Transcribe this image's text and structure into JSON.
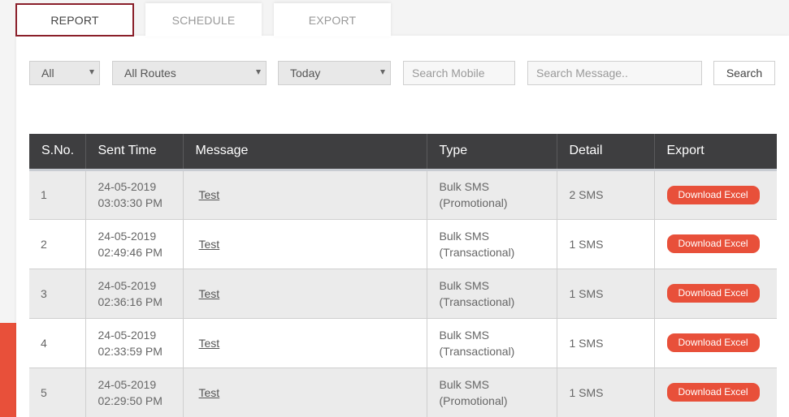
{
  "tabs": [
    {
      "label": "REPORT",
      "active": true
    },
    {
      "label": "SCHEDULE",
      "active": false
    },
    {
      "label": "EXPORT",
      "active": false
    }
  ],
  "filters": {
    "status": {
      "value": "All"
    },
    "routes": {
      "value": "All Routes"
    },
    "date": {
      "value": "Today"
    },
    "mobile": {
      "placeholder": "Search Mobile"
    },
    "message": {
      "placeholder": "Search Message.."
    },
    "search_label": "Search"
  },
  "table": {
    "headers": [
      "S.No.",
      "Sent Time",
      "Message",
      "Type",
      "Detail",
      "Export"
    ],
    "rows": [
      {
        "sno": "1",
        "date": "24-05-2019",
        "time": "03:03:30 PM",
        "message": "Test",
        "type_line1": "Bulk SMS",
        "type_line2": "(Promotional)",
        "detail": "2 SMS",
        "export": "Download Excel"
      },
      {
        "sno": "2",
        "date": "24-05-2019",
        "time": "02:49:46 PM",
        "message": "Test",
        "type_line1": "Bulk SMS",
        "type_line2": "(Transactional)",
        "detail": "1 SMS",
        "export": "Download Excel"
      },
      {
        "sno": "3",
        "date": "24-05-2019",
        "time": "02:36:16 PM",
        "message": "Test",
        "type_line1": "Bulk SMS",
        "type_line2": "(Transactional)",
        "detail": "1 SMS",
        "export": "Download Excel"
      },
      {
        "sno": "4",
        "date": "24-05-2019",
        "time": "02:33:59 PM",
        "message": "Test",
        "type_line1": "Bulk SMS",
        "type_line2": "(Transactional)",
        "detail": "1 SMS",
        "export": "Download Excel"
      },
      {
        "sno": "5",
        "date": "24-05-2019",
        "time": "02:29:50 PM",
        "message": "Test",
        "type_line1": "Bulk SMS",
        "type_line2": "(Promotional)",
        "detail": "1 SMS",
        "export": "Download Excel"
      }
    ]
  },
  "colors": {
    "accent": "#e8503a",
    "active_tab_border": "#8a1f2a",
    "header_bg": "#3e3e40"
  }
}
